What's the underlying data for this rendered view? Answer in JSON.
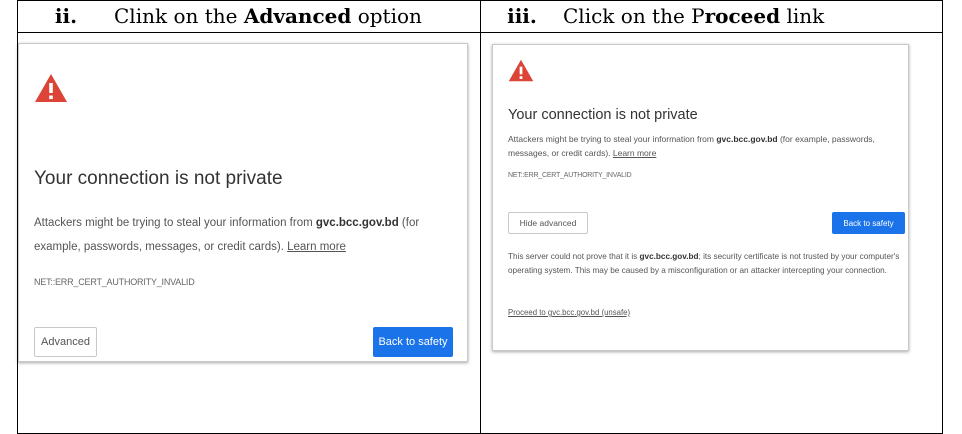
{
  "steps": [
    {
      "number": "ii.",
      "instruction_prefix": "Clink on the ",
      "instruction_bold": "Advanced",
      "instruction_suffix": " option",
      "screen": {
        "headline": "Your connection is not private",
        "message_prefix": "Attackers might be trying to steal your information from ",
        "domain": "gvc.bcc.gov.bd",
        "message_suffix": " (for example, passwords, messages, or credit cards). ",
        "learn_more": "Learn more",
        "error_code": "NET::ERR_CERT_AUTHORITY_INVALID",
        "advanced_button": "Advanced",
        "back_button": "Back to safety"
      }
    },
    {
      "number": "iii.",
      "instruction_prefix": "Click on the P",
      "instruction_bold": "roceed",
      "instruction_suffix": " link",
      "screen": {
        "headline": "Your connection is not private",
        "message_prefix": "Attackers might be trying to steal your information from ",
        "domain": "gvc.bcc.gov.bd",
        "message_suffix": " (for example, passwords, messages, or credit cards). ",
        "learn_more": "Learn more",
        "error_code": "NET::ERR_CERT_AUTHORITY_INVALID",
        "hide_advanced_button": "Hide advanced",
        "back_button": "Back to safety",
        "details_prefix": "This server could not prove that it is ",
        "details_domain": "gvc.bcc.gov.bd",
        "details_suffix": "; its security certificate is not trusted by your computer's operating system. This may be caused by a misconfiguration or an attacker intercepting your connection.",
        "proceed_link": "Proceed to gvc.bcc.gov.bd (unsafe)"
      }
    }
  ],
  "icons": {
    "warning": "warning-triangle-icon"
  },
  "colors": {
    "warning_red": "#db4437",
    "button_blue": "#1a73e8"
  }
}
